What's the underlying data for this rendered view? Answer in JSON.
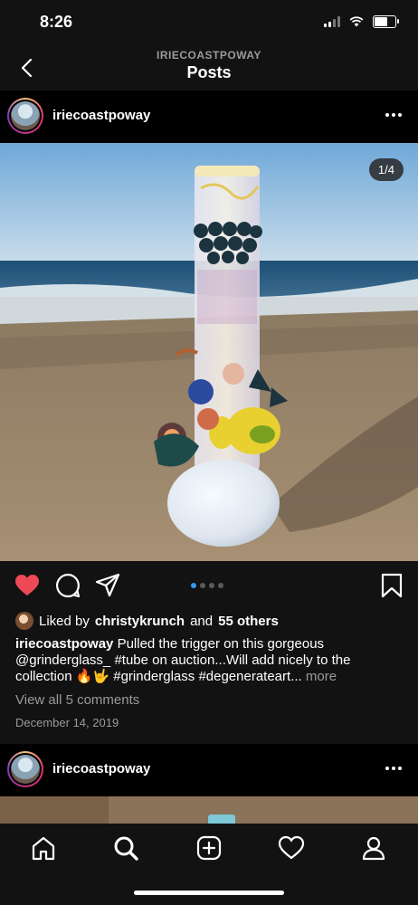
{
  "status": {
    "time": "8:26"
  },
  "nav": {
    "subtitle": "IRIECOASTPOWAY",
    "title": "Posts"
  },
  "post": {
    "username": "iriecoastpoway",
    "counter": "1/4",
    "liked_prefix": "Liked by",
    "liked_user": "christykrunch",
    "liked_middle": "and",
    "liked_count": "55 others",
    "caption_user": "iriecoastpoway",
    "caption_text": "Pulled the trigger on this gorgeous @grinderglass_ #tube on auction...Will add nicely to the collection 🔥🤟 #grinderglass #degenerateart...",
    "caption_more": "more",
    "view_comments": "View all 5 comments",
    "date": "December 14, 2019"
  },
  "next_post": {
    "username": "iriecoastpoway"
  },
  "icons": {
    "back": "chevron-left-icon",
    "heart": "heart-icon",
    "comment": "comment-icon",
    "share": "send-icon",
    "save": "bookmark-icon",
    "home": "home-icon",
    "search": "search-icon",
    "add": "add-post-icon",
    "activity": "heart-outline-icon",
    "profile": "profile-icon"
  },
  "colors": {
    "like": "#ed4956",
    "dot_active": "#3897f0",
    "background": "#000000"
  }
}
